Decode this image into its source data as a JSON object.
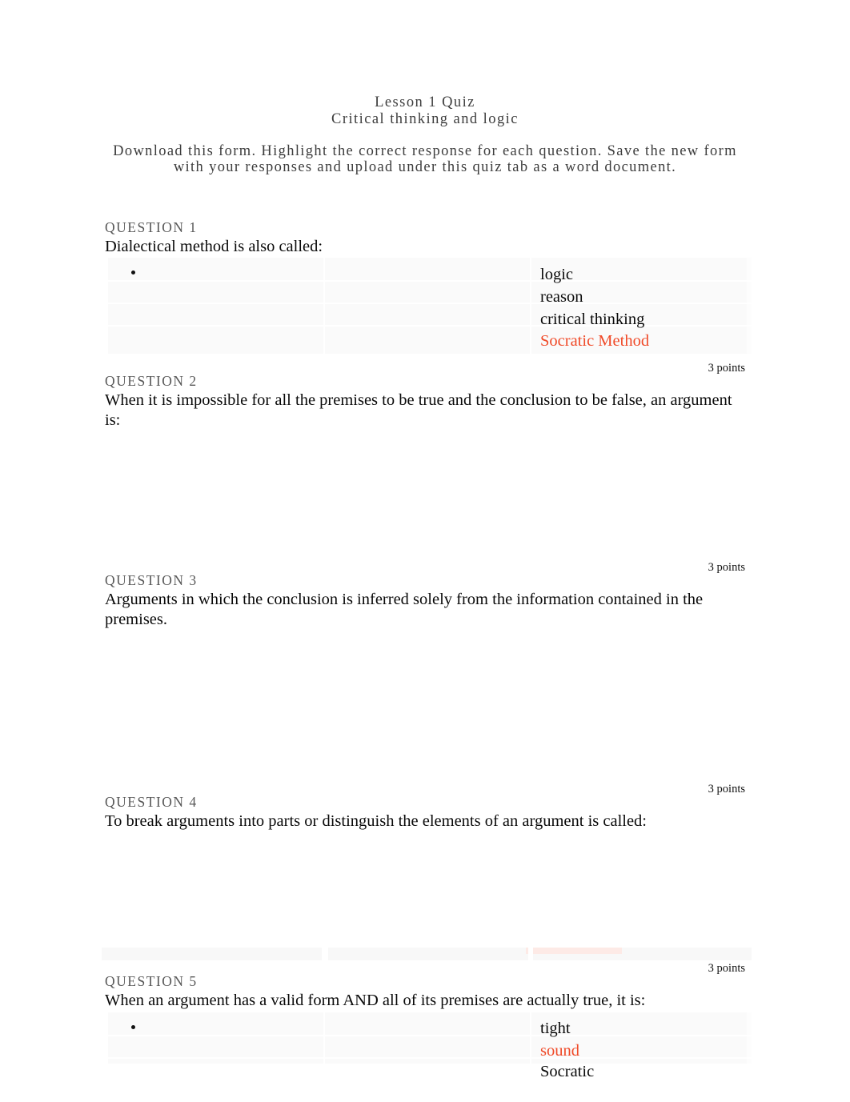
{
  "header": {
    "title": "Lesson 1 Quiz",
    "subtitle": "Critical thinking and logic",
    "instructions": "Download this form. Highlight the correct response for each question. Save the new form with your responses and upload under this quiz tab as a word document."
  },
  "colors": {
    "highlight": "#f04a28",
    "question_label": "#585858",
    "header_text": "#3d3d3d",
    "table_fill": "#fafafa"
  },
  "points_label": "3 points",
  "questions": [
    {
      "label": "QUESTION 1",
      "text": "Dialectical method is also called:",
      "points": "3 points",
      "options": [
        {
          "text": "logic",
          "highlighted": false
        },
        {
          "text": "reason",
          "highlighted": false
        },
        {
          "text": "critical thinking",
          "highlighted": false
        },
        {
          "text": "Socratic Method",
          "highlighted": true
        }
      ]
    },
    {
      "label": "QUESTION 2",
      "text": "When it is impossible for all the premises to be true and the conclusion to be false, an argument is:",
      "points": "3 points",
      "options": []
    },
    {
      "label": "QUESTION 3",
      "text": "Arguments in which the conclusion is inferred solely from the information contained in the premises.",
      "points": "3 points",
      "options": []
    },
    {
      "label": "QUESTION 4",
      "text": "To break arguments into parts or distinguish the elements of an argument is called:",
      "points": "3 points",
      "options": []
    },
    {
      "label": "QUESTION 5",
      "text": "When an argument has a valid form AND all of its premises are actually true, it is:",
      "points": "3 points",
      "options": [
        {
          "text": "tight",
          "highlighted": false
        },
        {
          "text": "sound",
          "highlighted": true
        },
        {
          "text": "Socratic",
          "highlighted": false
        }
      ]
    }
  ]
}
